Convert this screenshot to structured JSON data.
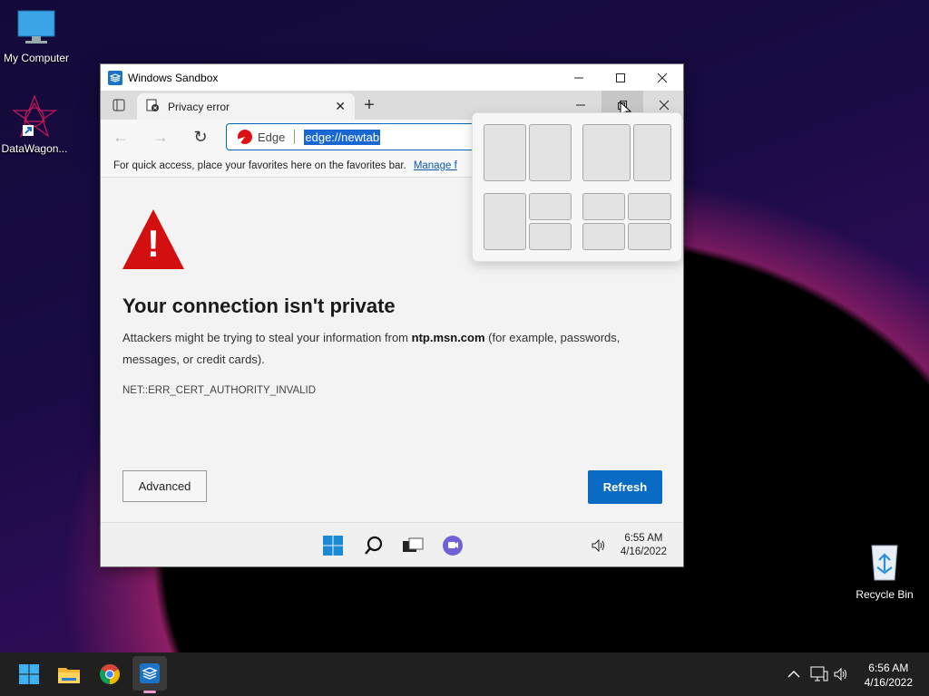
{
  "desktop": {
    "icons": [
      {
        "label": "My Computer"
      },
      {
        "label": "DataWagon..."
      },
      {
        "label": "Recycle Bin"
      }
    ]
  },
  "sandbox": {
    "title": "Windows Sandbox",
    "edge": {
      "tab_title": "Privacy error",
      "omnibox_label": "Edge",
      "url": "edge://newtab",
      "favbar_text": "For quick access, place your favorites here on the favorites bar.",
      "favbar_link": "Manage f",
      "error": {
        "title": "Your connection isn't private",
        "body_prefix": "Attackers might be trying to steal your information from ",
        "body_host": "ntp.msn.com",
        "body_suffix": " (for example, passwords, messages, or credit cards).",
        "code": "NET::ERR_CERT_AUTHORITY_INVALID",
        "advanced_label": "Advanced",
        "refresh_label": "Refresh"
      }
    },
    "inner_taskbar": {
      "time": "6:55 AM",
      "date": "4/16/2022"
    }
  },
  "taskbar": {
    "time": "6:56 AM",
    "date": "4/16/2022"
  }
}
